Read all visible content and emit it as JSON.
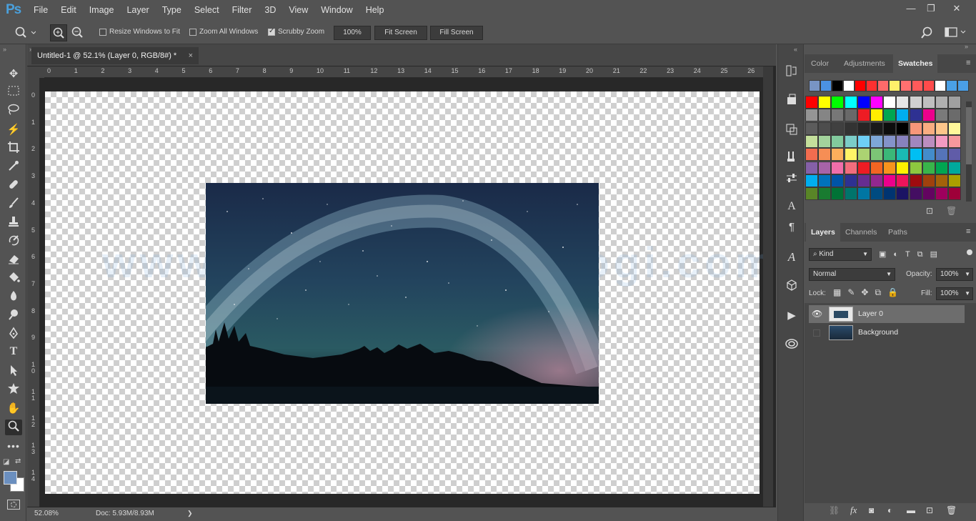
{
  "app": {
    "logo": "Ps"
  },
  "menu": [
    "File",
    "Edit",
    "Image",
    "Layer",
    "Type",
    "Select",
    "Filter",
    "3D",
    "View",
    "Window",
    "Help"
  ],
  "window_controls": {
    "minimize": "—",
    "restore": "❐",
    "close": "✕"
  },
  "options": {
    "resize_windows_label": "Resize Windows to Fit",
    "zoom_all_label": "Zoom All Windows",
    "scrubby_zoom_label": "Scrubby Zoom",
    "zoom_value": "100%",
    "fit_screen": "Fit Screen",
    "fill_screen": "Fill Screen",
    "scrubby_checked": true
  },
  "document": {
    "tab_title": "Untitled-1 @ 52.1% (Layer 0, RGB/8#) *",
    "close": "×"
  },
  "ruler": {
    "top_ticks": [
      "0",
      "1",
      "2",
      "3",
      "4",
      "5",
      "6",
      "7",
      "8",
      "9",
      "10",
      "11",
      "12",
      "13",
      "14",
      "15",
      "16",
      "17",
      "18",
      "19",
      "20",
      "21",
      "22",
      "23",
      "24",
      "25",
      "26"
    ],
    "left_ticks": [
      "0",
      "1",
      "2",
      "3",
      "4",
      "5",
      "6",
      "7",
      "8",
      "9",
      "1\n0",
      "1\n1",
      "1\n2",
      "1\n3",
      "1\n4"
    ]
  },
  "status": {
    "zoom": "52.08%",
    "doc": "Doc: 5.93M/8.93M",
    "arrow": "❯"
  },
  "watermark": "www.blogkomputerlogi.com",
  "color_panel": {
    "tabs": [
      "Color",
      "Adjustments",
      "Swatches"
    ],
    "active_tab": "Swatches",
    "recent_swatches": [
      "#7894c4",
      "#4b92e3",
      "#000000",
      "#ffffff",
      "#ff0000",
      "#ff3030",
      "#ff6a6a",
      "#fff06a",
      "#ff7070",
      "#ff5a5a",
      "#ff4b4b",
      "#ffffff",
      "#4aa0e6",
      "#4a9ee6"
    ],
    "swatch_rows": [
      [
        "#ff0000",
        "#ffff00",
        "#00ff00",
        "#00ffff",
        "#0000ff",
        "#ff00ff",
        "#ffffff",
        "#e6e6e6",
        "#d0d0d0",
        "#bfbfbf",
        "#b0b0b0",
        "#a0a0a0"
      ],
      [
        "#959595",
        "#858585",
        "#777777",
        "#696969",
        "#ed1c24",
        "#ffed00",
        "#00a651",
        "#00aeef",
        "#2e3192",
        "#ec008c",
        "#7a7a7a",
        "#6b6b6b"
      ],
      [
        "#5c5c5c",
        "#4d4d4d",
        "#404040",
        "#333333",
        "#262626",
        "#1a1a1a",
        "#0d0d0d",
        "#000000",
        "#f7977a",
        "#f9ad81",
        "#fdc68a",
        "#fff79a"
      ],
      [
        "#c4df9b",
        "#a3d39c",
        "#82ca9d",
        "#7bcdc8",
        "#6ecff6",
        "#7ea7d8",
        "#8493ca",
        "#8882be",
        "#a187be",
        "#bc8dbf",
        "#f49ac2",
        "#f6989d"
      ],
      [
        "#f26c4f",
        "#f68e55",
        "#fbaf5c",
        "#fff467",
        "#acd372",
        "#7cc576",
        "#3bb878",
        "#1abbb4",
        "#00bff3",
        "#438ccb",
        "#5574b9",
        "#605ca8"
      ],
      [
        "#8560a8",
        "#a763a8",
        "#f06eaa",
        "#f26d7d",
        "#ed1c24",
        "#f26522",
        "#f7941d",
        "#fff200",
        "#8dc73f",
        "#39b54a",
        "#00a651",
        "#00a99d"
      ],
      [
        "#00aeef",
        "#0072bc",
        "#0054a6",
        "#2e3192",
        "#662d91",
        "#92278f",
        "#ec008c",
        "#ed145b",
        "#9e0b0f",
        "#a0410d",
        "#a3620a",
        "#aba000"
      ],
      [
        "#598527",
        "#197b30",
        "#007236",
        "#00746b",
        "#0076a3",
        "#004b80",
        "#003471",
        "#1b1464",
        "#440e62",
        "#630460",
        "#9e005d",
        "#9e0039"
      ]
    ]
  },
  "layers_panel": {
    "tabs": [
      "Layers",
      "Channels",
      "Paths"
    ],
    "active_tab": "Layers",
    "kind_label": "Kind",
    "blend_mode": "Normal",
    "opacity_label": "Opacity:",
    "opacity_value": "100%",
    "lock_label": "Lock:",
    "fill_label": "Fill:",
    "fill_value": "100%",
    "layers": [
      {
        "name": "Layer 0",
        "visible": true,
        "selected": true
      },
      {
        "name": "Background",
        "visible": false,
        "selected": false
      }
    ],
    "footer_fx": "fx"
  }
}
